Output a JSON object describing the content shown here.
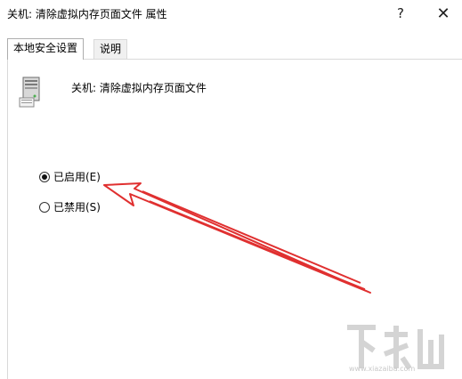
{
  "window": {
    "title": "关机: 清除虚拟内存页面文件 属性",
    "help_label": "?",
    "close_label": "✕"
  },
  "tabs": [
    {
      "label": "本地安全设置",
      "active": true
    },
    {
      "label": "说明",
      "active": false
    }
  ],
  "policy": {
    "icon": "server-computer-icon",
    "name": "关机: 清除虚拟内存页面文件"
  },
  "options": [
    {
      "label": "已启用(E)",
      "selected": true
    },
    {
      "label": "已禁用(S)",
      "selected": false
    }
  ],
  "annotation": {
    "arrow_color": "#e03030"
  },
  "watermark": {
    "text": "www.xiazaiba.com",
    "logo_text": "下载吧"
  }
}
